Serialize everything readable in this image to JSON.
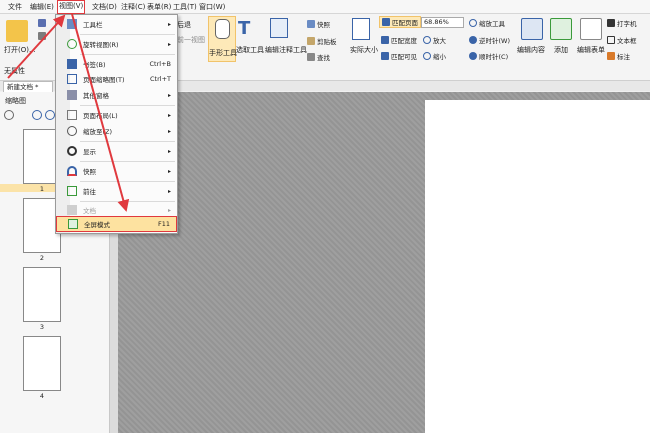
{
  "menubar": [
    "文件",
    "编辑(E)",
    "视图(V)",
    "文档(D)",
    "注释(C)",
    "表单(R)",
    "工具(T)",
    "窗口(W)"
  ],
  "ribbon": {
    "open": "打开(O)...",
    "no_property": "无属性",
    "back_view": "前一视图",
    "forward": "后退",
    "hand_tool": "手形工具",
    "select_text": "选取工具",
    "edit_annot": "编辑注释工具",
    "snapshot": "快照",
    "clipboard": "剪贴板",
    "find": "查找",
    "actual_size": "实际大小",
    "fit_page": "匹配页面",
    "fit_width": "匹配宽度",
    "fit_visible": "匹配可见",
    "zoom_value": "68.86%",
    "zoom_tool": "缩放工具",
    "zoom_in": "放大",
    "zoom_out": "缩小",
    "rotate_ccw": "逆时针(W)",
    "rotate_cw": "顺时针(C)",
    "edit_content": "编辑内容",
    "add": "添加",
    "edit_form": "编辑表单",
    "typewriter": "打字机",
    "textbox": "文本框",
    "mark": "标注"
  },
  "doc_tab": "新建文档 *",
  "left_pane": {
    "title": "缩略图",
    "pages": [
      "1",
      "2",
      "3",
      "4"
    ]
  },
  "view_menu": {
    "items": [
      {
        "label": "工具栏",
        "shortcut": "",
        "submenu": true,
        "disabled": false
      },
      {
        "label": "旋转视图(R)",
        "shortcut": "",
        "submenu": true,
        "disabled": false
      },
      {
        "label": "书签(B)",
        "shortcut": "Ctrl+B",
        "submenu": false,
        "disabled": false
      },
      {
        "label": "页面缩略图(T)",
        "shortcut": "Ctrl+T",
        "submenu": false,
        "disabled": false
      },
      {
        "label": "其他窗格",
        "shortcut": "",
        "submenu": true,
        "disabled": false
      },
      {
        "label": "页面布局(L)",
        "shortcut": "",
        "submenu": true,
        "disabled": false
      },
      {
        "label": "缩放至(Z)",
        "shortcut": "",
        "submenu": true,
        "disabled": false
      },
      {
        "label": "显示",
        "shortcut": "",
        "submenu": true,
        "disabled": false
      },
      {
        "label": "快照",
        "shortcut": "",
        "submenu": true,
        "disabled": false
      },
      {
        "label": "前往",
        "shortcut": "",
        "submenu": true,
        "disabled": false
      },
      {
        "label": "文档",
        "shortcut": "",
        "submenu": true,
        "disabled": true
      },
      {
        "label": "全屏模式",
        "shortcut": "F11",
        "submenu": false,
        "disabled": false
      }
    ]
  },
  "colors": {
    "highlight_red": "#e0393e",
    "selection_yellow": "#fde2a0"
  }
}
